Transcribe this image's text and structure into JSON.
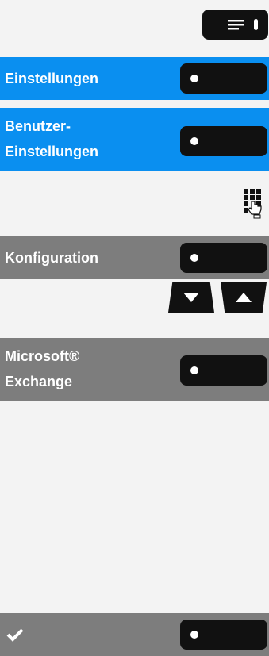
{
  "menu_button": {
    "icon": "menu-icon"
  },
  "rows": [
    {
      "label": "Einstellungen"
    },
    {
      "label_line1": "Benutzer-",
      "label_line2": "Einstellungen"
    },
    {
      "label": "Konfiguration"
    },
    {
      "label_line1": "Microsoft®",
      "label_line2": "Exchange"
    }
  ],
  "keypad_icon": "keypad-hand-icon",
  "nav": {
    "down_icon": "triangle-down-icon",
    "up_icon": "triangle-up-icon"
  },
  "confirm": {
    "icon": "checkmark-icon"
  },
  "colors": {
    "blue": "#0a8ff0",
    "grey": "#7d7d7d",
    "button": "#111111",
    "background": "#f3f3f3"
  }
}
